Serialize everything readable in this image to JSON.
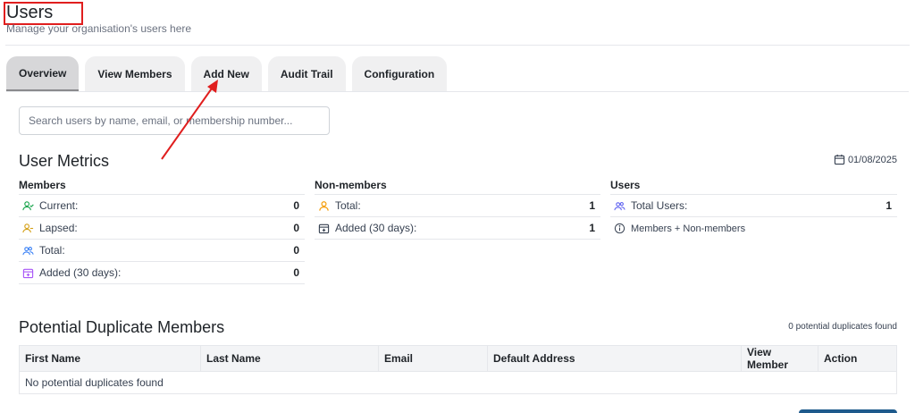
{
  "header": {
    "title": "Users",
    "subtitle": "Manage your organisation's users here"
  },
  "tabs": [
    {
      "label": "Overview",
      "active": true
    },
    {
      "label": "View Members",
      "active": false
    },
    {
      "label": "Add New",
      "active": false
    },
    {
      "label": "Audit Trail",
      "active": false
    },
    {
      "label": "Configuration",
      "active": false
    }
  ],
  "search": {
    "placeholder": "Search users by name, email, or membership number...",
    "value": ""
  },
  "metrics": {
    "title": "User Metrics",
    "date": "01/08/2025",
    "members": {
      "heading": "Members",
      "rows": [
        {
          "label": "Current:",
          "value": "0",
          "icon": "user-check-icon",
          "color": "#16a34a"
        },
        {
          "label": "Lapsed:",
          "value": "0",
          "icon": "user-clock-icon",
          "color": "#d4a017"
        },
        {
          "label": "Total:",
          "value": "0",
          "icon": "users-icon",
          "color": "#3b82f6"
        },
        {
          "label": "Added (30 days):",
          "value": "0",
          "icon": "calendar-icon",
          "color": "#a855f7"
        }
      ]
    },
    "non_members": {
      "heading": "Non-members",
      "rows": [
        {
          "label": "Total:",
          "value": "1",
          "icon": "user-icon",
          "color": "#f59e0b"
        },
        {
          "label": "Added (30 days):",
          "value": "1",
          "icon": "calendar-icon",
          "color": "#374151"
        }
      ]
    },
    "users": {
      "heading": "Users",
      "rows": [
        {
          "label": "Total Users:",
          "value": "1",
          "icon": "users-icon",
          "color": "#6366f1"
        }
      ],
      "note": "Members + Non-members"
    }
  },
  "duplicates": {
    "title": "Potential Duplicate Members",
    "count_text": "0 potential duplicates found",
    "columns": [
      "First Name",
      "Last Name",
      "Email",
      "Default Address",
      "View Member",
      "Action"
    ],
    "empty_text": "No potential duplicates found"
  },
  "colors": {
    "annotation": "#e01e1e",
    "active_tab": "#d7d7d9",
    "primary_button": "#1e5a8c"
  }
}
